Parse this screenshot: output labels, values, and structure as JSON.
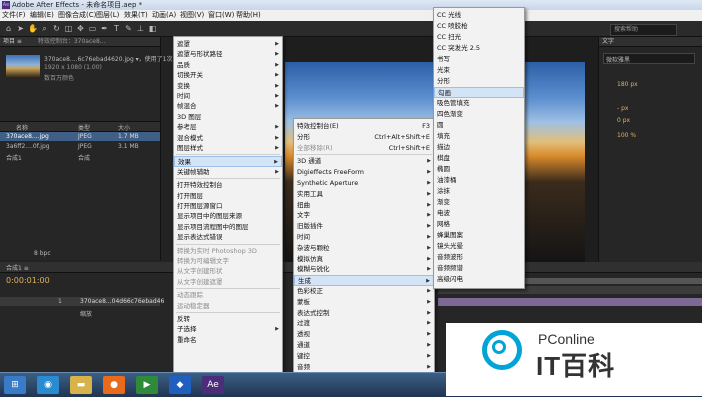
{
  "window": {
    "title": "Adobe After Effects - 未命名项目.aep *",
    "app_icon": "Ae"
  },
  "menubar": [
    "文件(F)",
    "编辑(E)",
    "图像合成(C)",
    "图层(L)",
    "效果(T)",
    "动画(A)",
    "视图(V)",
    "窗口(W)",
    "帮助(H)"
  ],
  "toolbar": {
    "help_placeholder": "搜索帮助"
  },
  "project": {
    "tab": "项目 ≡",
    "controls_tab": "特效控制台：370ace8…",
    "file_name": "370ace8....6c76ebad4620.jpg ▾，使用了1次",
    "file_dims": "1920 x 1080 (1.00)",
    "file_color": "数百万颜色",
    "col_name": "名称",
    "col_type": "类型",
    "col_size": "大小",
    "items": [
      {
        "name": "370ace8....jpg",
        "type": "JPEG",
        "size": "1.7 MB"
      },
      {
        "name": "3a6ff2....0f.jpg",
        "type": "JPEG",
        "size": "3.1 MB"
      },
      {
        "name": "合成1",
        "type": "合成",
        "size": ""
      }
    ],
    "bpc": "8 bpc"
  },
  "timeline": {
    "tab": "合成1 ≡",
    "timecode": "0:00:01:00",
    "layer_num": "1",
    "layer_name": "370ace8...04d66c76ebad46",
    "layer_sub": "缩放"
  },
  "right_panel": {
    "tab": "文字",
    "font": "微软雅黑",
    "size1": "180 px",
    "size2": "- px",
    "size3": "0 px",
    "pct": "100 %"
  },
  "layer_menu": {
    "items": [
      {
        "label": "遮罩",
        "arrow": true
      },
      {
        "label": "遮罩与形状路径",
        "arrow": true
      },
      {
        "label": "品质",
        "arrow": true
      },
      {
        "label": "切换开关",
        "arrow": true
      },
      {
        "label": "变换",
        "arrow": true
      },
      {
        "label": "时间",
        "arrow": true
      },
      {
        "label": "帧混合",
        "arrow": true
      },
      {
        "label": "3D 图层",
        "arrow": false
      },
      {
        "label": "参考层",
        "arrow": true
      },
      {
        "label": "混合模式",
        "arrow": true
      },
      {
        "label": "图层样式",
        "arrow": true
      },
      {
        "sep": true
      },
      {
        "label": "效果",
        "arrow": true,
        "hl": true
      },
      {
        "label": "关键帧辅助",
        "arrow": true
      },
      {
        "sep": true
      },
      {
        "label": "打开特效控制台"
      },
      {
        "label": "打开图层"
      },
      {
        "label": "打开图层源窗口"
      },
      {
        "label": "显示项目中的图层来源"
      },
      {
        "label": "显示项目流程图中的图层"
      },
      {
        "label": "显示表达式错误"
      },
      {
        "sep": true
      },
      {
        "label": "转换为实时 Photoshop 3D",
        "dis": true
      },
      {
        "label": "转换为可编辑文字",
        "dis": true
      },
      {
        "label": "从文字创建形状",
        "dis": true
      },
      {
        "label": "从文字创建遮罩",
        "dis": true
      },
      {
        "sep": true
      },
      {
        "label": "动态跟踪",
        "dis": true
      },
      {
        "label": "运动稳定器",
        "dis": true
      },
      {
        "sep": true
      },
      {
        "label": "反转"
      },
      {
        "label": "子选择",
        "arrow": true
      },
      {
        "label": "重命名"
      }
    ]
  },
  "effects_menu": {
    "items": [
      {
        "label": "特效控制台(E)",
        "shortcut": "F3"
      },
      {
        "label": "分形",
        "shortcut": "Ctrl+Alt+Shift+E"
      },
      {
        "label": "全部移除(R)",
        "shortcut": "Ctrl+Shift+E",
        "dis": true
      },
      {
        "sep": true
      },
      {
        "label": "3D 通道",
        "arrow": true
      },
      {
        "label": "Digieffects FreeForm",
        "arrow": true
      },
      {
        "label": "Synthetic Aperture",
        "arrow": true
      },
      {
        "label": "实用工具",
        "arrow": true
      },
      {
        "label": "扭曲",
        "arrow": true
      },
      {
        "label": "文字",
        "arrow": true
      },
      {
        "label": "旧版插件",
        "arrow": true
      },
      {
        "label": "时间",
        "arrow": true
      },
      {
        "label": "杂波与颗粒",
        "arrow": true
      },
      {
        "label": "模拟仿真",
        "arrow": true
      },
      {
        "label": "模糊与锐化",
        "arrow": true
      },
      {
        "label": "生成",
        "arrow": true,
        "hl": true
      },
      {
        "label": "色彩校正",
        "arrow": true
      },
      {
        "label": "蒙板",
        "arrow": true
      },
      {
        "label": "表达式控制",
        "arrow": true
      },
      {
        "label": "过渡",
        "arrow": true
      },
      {
        "label": "透视",
        "arrow": true
      },
      {
        "label": "通道",
        "arrow": true
      },
      {
        "label": "键控",
        "arrow": true
      },
      {
        "label": "音频",
        "arrow": true
      },
      {
        "label": "风格化",
        "arrow": true
      }
    ]
  },
  "generate_menu": {
    "items": [
      {
        "label": "CC 光线"
      },
      {
        "label": "CC 喷胶枪"
      },
      {
        "label": "CC 扫光"
      },
      {
        "label": "CC 突发光 2.5"
      },
      {
        "label": "书写"
      },
      {
        "label": "光束"
      },
      {
        "label": "分形"
      },
      {
        "label": "勾画",
        "hl": true
      },
      {
        "label": "吸色管填充"
      },
      {
        "label": "四色渐变"
      },
      {
        "label": "圆"
      },
      {
        "label": "填充"
      },
      {
        "label": "描边"
      },
      {
        "label": "棋盘"
      },
      {
        "label": "椭圆"
      },
      {
        "label": "油漆桶"
      },
      {
        "label": "涂抹"
      },
      {
        "label": "渐变"
      },
      {
        "label": "电波"
      },
      {
        "label": "网格"
      },
      {
        "label": "蜂巢图案"
      },
      {
        "label": "镜头光晕"
      },
      {
        "label": "音频波形"
      },
      {
        "label": "音频频谱"
      },
      {
        "label": "高级闪电"
      }
    ]
  },
  "taskbar": {
    "items": [
      {
        "icon": "start-orb-icon",
        "label": "⊞",
        "color": "#3a7bc8"
      },
      {
        "icon": "globe-icon",
        "label": "◉",
        "color": "#2a8bd0"
      },
      {
        "icon": "folder-icon",
        "label": "▬",
        "color": "#d8b24a"
      },
      {
        "icon": "firefox-icon",
        "label": "●",
        "color": "#e86a1c"
      },
      {
        "icon": "media-player-icon",
        "label": "▶",
        "color": "#2f8a3a"
      },
      {
        "icon": "app-icon",
        "label": "◆",
        "color": "#1f5fbf"
      },
      {
        "icon": "ae-icon",
        "label": "Ae",
        "color": "#4b2d7a"
      }
    ]
  },
  "watermark": {
    "line1": "PConline",
    "line2": "IT百科"
  }
}
